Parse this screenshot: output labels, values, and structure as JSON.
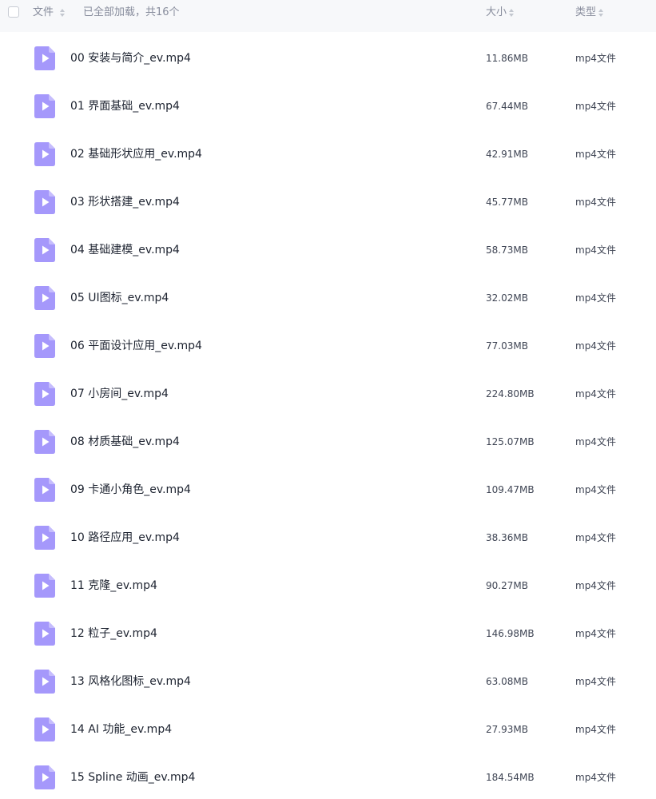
{
  "header": {
    "col_file": "文件",
    "loaded_status": "已全部加载，共16个",
    "col_size": "大小",
    "col_type": "类型"
  },
  "colors": {
    "icon_purple": "#a598fb",
    "header_bg": "#f7f8fa"
  },
  "files": [
    {
      "name": "00 安装与简介_ev.mp4",
      "size": "11.86MB",
      "type": "mp4文件",
      "icon": "video-file-icon"
    },
    {
      "name": "01 界面基础_ev.mp4",
      "size": "67.44MB",
      "type": "mp4文件",
      "icon": "video-file-icon"
    },
    {
      "name": "02 基础形状应用_ev.mp4",
      "size": "42.91MB",
      "type": "mp4文件",
      "icon": "video-file-icon"
    },
    {
      "name": "03 形状搭建_ev.mp4",
      "size": "45.77MB",
      "type": "mp4文件",
      "icon": "video-file-icon"
    },
    {
      "name": "04 基础建模_ev.mp4",
      "size": "58.73MB",
      "type": "mp4文件",
      "icon": "video-file-icon"
    },
    {
      "name": "05 UI图标_ev.mp4",
      "size": "32.02MB",
      "type": "mp4文件",
      "icon": "video-file-icon"
    },
    {
      "name": "06 平面设计应用_ev.mp4",
      "size": "77.03MB",
      "type": "mp4文件",
      "icon": "video-file-icon"
    },
    {
      "name": "07 小房间_ev.mp4",
      "size": "224.80MB",
      "type": "mp4文件",
      "icon": "video-file-icon"
    },
    {
      "name": "08 材质基础_ev.mp4",
      "size": "125.07MB",
      "type": "mp4文件",
      "icon": "video-file-icon"
    },
    {
      "name": "09 卡通小角色_ev.mp4",
      "size": "109.47MB",
      "type": "mp4文件",
      "icon": "video-file-icon"
    },
    {
      "name": "10 路径应用_ev.mp4",
      "size": "38.36MB",
      "type": "mp4文件",
      "icon": "video-file-icon"
    },
    {
      "name": "11 克隆_ev.mp4",
      "size": "90.27MB",
      "type": "mp4文件",
      "icon": "video-file-icon"
    },
    {
      "name": "12 粒子_ev.mp4",
      "size": "146.98MB",
      "type": "mp4文件",
      "icon": "video-file-icon"
    },
    {
      "name": "13 风格化图标_ev.mp4",
      "size": "63.08MB",
      "type": "mp4文件",
      "icon": "video-file-icon"
    },
    {
      "name": "14 AI 功能_ev.mp4",
      "size": "27.93MB",
      "type": "mp4文件",
      "icon": "video-file-icon"
    },
    {
      "name": "15 Spline 动画_ev.mp4",
      "size": "184.54MB",
      "type": "mp4文件",
      "icon": "video-file-icon"
    }
  ]
}
